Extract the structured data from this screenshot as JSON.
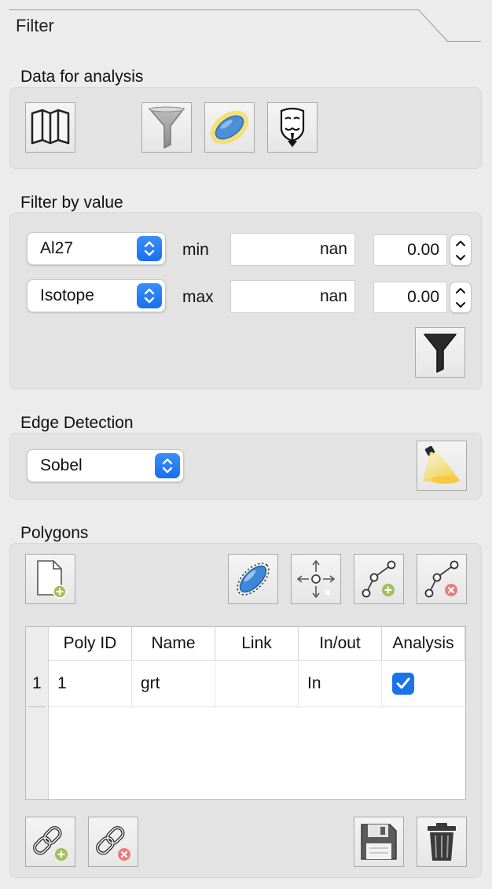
{
  "tab": {
    "title": "Filter"
  },
  "data_for_analysis": {
    "heading": "Data for analysis",
    "buttons": [
      "map-icon",
      "funnel-icon",
      "polygon-highlight-icon",
      "mask-icon"
    ]
  },
  "filter_by_value": {
    "heading": "Filter by value",
    "row1": {
      "select": "Al27",
      "label": "min",
      "field": "nan",
      "spin": "0.00"
    },
    "row2": {
      "select": "Isotope",
      "label": "max",
      "field": "nan",
      "spin": "0.00"
    },
    "apply_button": "funnel-dark-icon"
  },
  "edge_detection": {
    "heading": "Edge Detection",
    "select": "Sobel",
    "button": "spotlight-icon"
  },
  "polygons": {
    "heading": "Polygons",
    "toolbar": [
      "new-document-icon",
      "polygon-edit-icon",
      "move-point-icon",
      "add-point-icon",
      "remove-point-icon"
    ],
    "table": {
      "columns": [
        "Poly ID",
        "Name",
        "Link",
        "In/out",
        "Analysis"
      ],
      "rows": [
        {
          "index": "1",
          "poly_id": "1",
          "name": "grt",
          "link": "",
          "in_out": "In",
          "analysis": true
        }
      ]
    },
    "bottom_buttons": [
      "link-add-icon",
      "link-remove-icon",
      "save-icon",
      "trash-icon"
    ]
  },
  "colors": {
    "accent": "#1a73e8",
    "group_bg": "#e3e3e3",
    "window_bg": "#ececec"
  }
}
